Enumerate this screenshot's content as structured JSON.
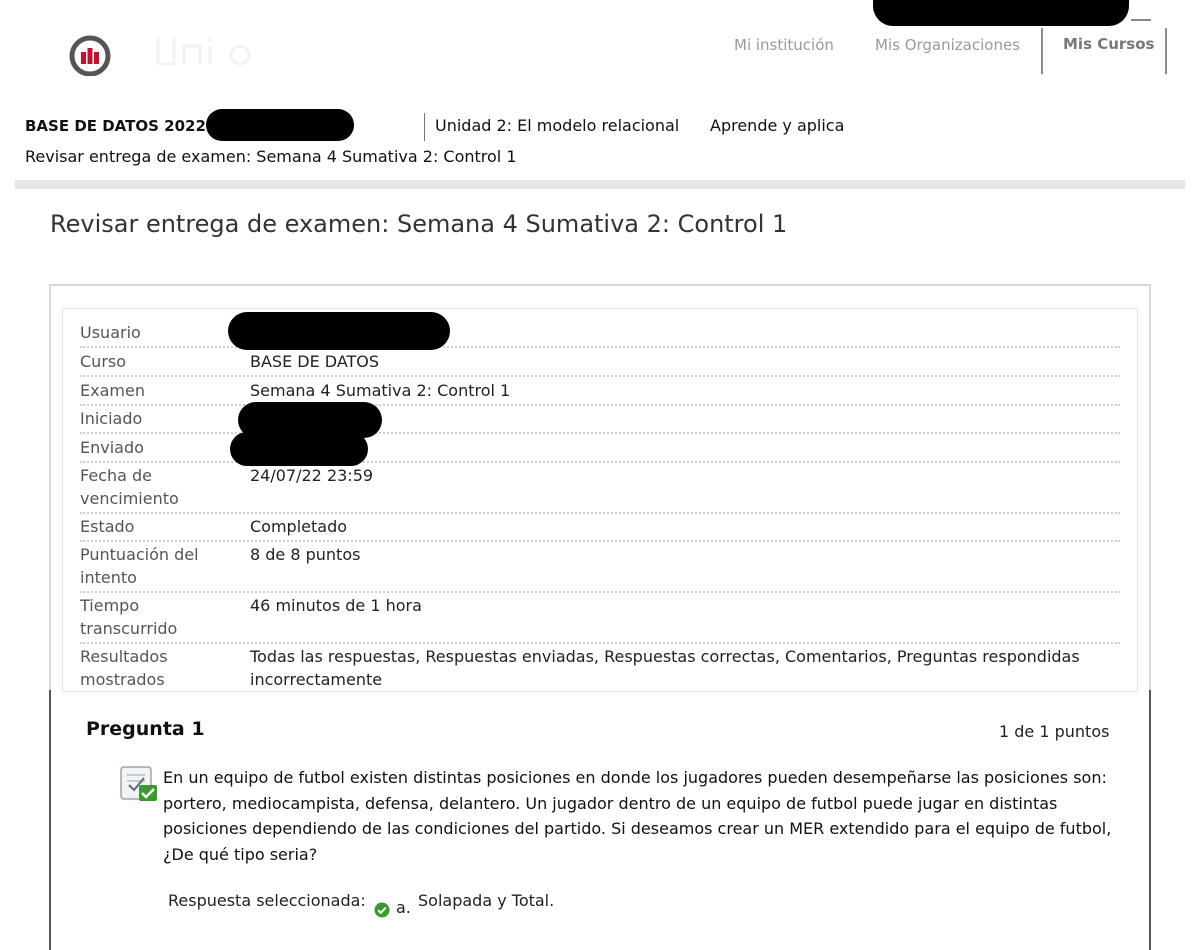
{
  "header": {
    "nav": {
      "mi_institucion": "Mi institución",
      "mis_organizaciones": "Mis Organizaciones",
      "mis_cursos": "Mis Cursos"
    }
  },
  "breadcrumb": {
    "course": "BASE DE DATOS 20221",
    "unit": "Unidad 2: El modelo relacional",
    "section": "Aprende y aplica",
    "current": "Revisar entrega de examen: Semana 4 Sumativa 2: Control 1"
  },
  "page": {
    "title": "Revisar entrega de examen: Semana 4 Sumativa 2: Control 1"
  },
  "details": [
    {
      "label": "Usuario",
      "value": ""
    },
    {
      "label": "Curso",
      "value": "BASE DE DATOS"
    },
    {
      "label": "Examen",
      "value": "Semana 4 Sumativa 2: Control 1"
    },
    {
      "label": "Iniciado",
      "value": ""
    },
    {
      "label": "Enviado",
      "value": ""
    },
    {
      "label": "Fecha de vencimiento",
      "value": "24/07/22 23:59"
    },
    {
      "label": "Estado",
      "value": "Completado"
    },
    {
      "label": "Puntuación del intento",
      "value": "8 de 8 puntos"
    },
    {
      "label": "Tiempo transcurrido",
      "value": "46 minutos de 1 hora"
    },
    {
      "label": "Resultados mostrados",
      "value": "Todas las respuestas, Respuestas enviadas, Respuestas correctas, Comentarios, Preguntas respondidas incorrectamente"
    }
  ],
  "question": {
    "title": "Pregunta 1",
    "points": "1 de 1 puntos",
    "text": "En un equipo de futbol existen distintas posiciones en donde los jugadores pueden desempeñarse las posiciones son: portero, mediocampista, defensa, delantero. Un jugador dentro de un equipo de futbol puede jugar en distintas posiciones dependiendo de las condiciones del partido. Si deseamos crear un MER extendido para el equipo de futbol, ¿De qué tipo seria?",
    "answer_label": "Respuesta seleccionada:",
    "answer_letter": "a.",
    "answer_text": "Solapada y Total.",
    "correct_color": "#3a9a2e"
  }
}
